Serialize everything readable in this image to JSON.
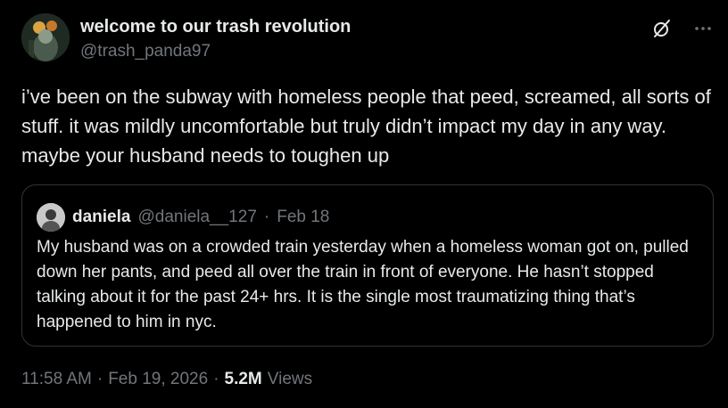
{
  "author": {
    "display_name": "welcome to our trash revolution",
    "handle": "@trash_panda97",
    "avatar_icon": "profile-photo"
  },
  "actions": {
    "grok_icon": "grok-slash-icon",
    "more_icon": "ellipsis-icon"
  },
  "tweet": {
    "text": "i’ve been on the subway with homeless people that peed, screamed, all sorts of stuff. it was mildly uncomfortable but truly didn’t impact my day in any way. maybe your husband needs to toughen up"
  },
  "quote": {
    "display_name": "daniela",
    "handle": "@daniela__127",
    "separator": "·",
    "date": "Feb 18",
    "text": "My husband was on a crowded train yesterday when a homeless woman got on, pulled down her pants, and peed all over the train in front of everyone. He hasn’t stopped talking about it for the past 24+ hrs. It is the single most traumatizing thing that’s happened to him in nyc."
  },
  "footer": {
    "time": "11:58 AM",
    "separator": "·",
    "date": "Feb 19, 2026",
    "separator2": "·",
    "views_count": "5.2M",
    "views_label": "Views"
  },
  "colors": {
    "background": "#000000",
    "text_primary": "#e7e9ea",
    "text_secondary": "#71767b",
    "border": "#2f3336"
  }
}
